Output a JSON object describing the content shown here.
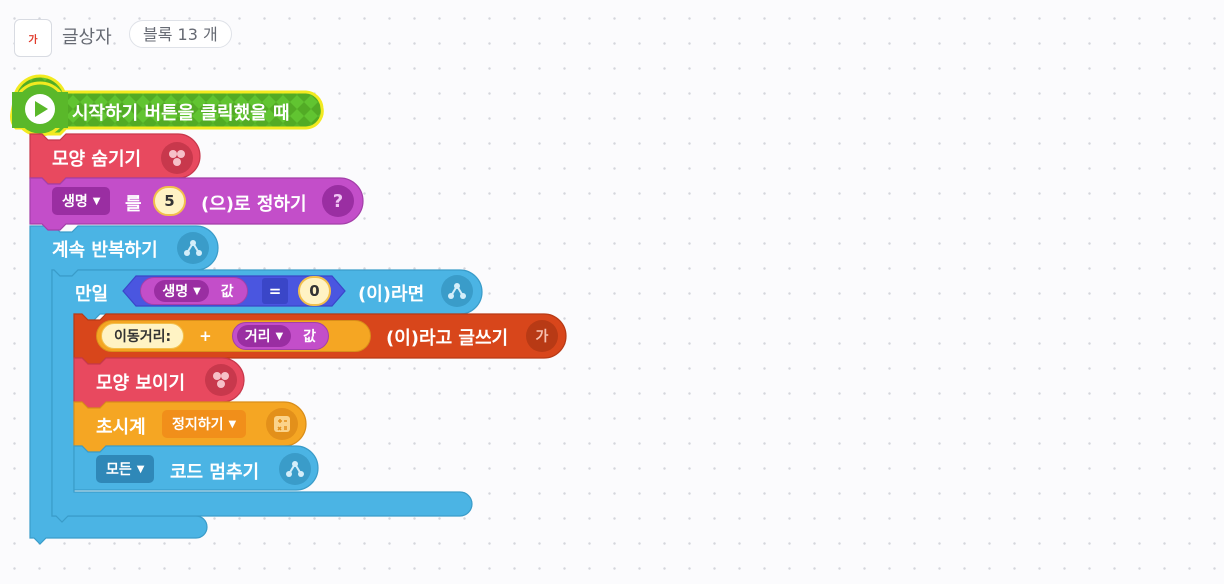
{
  "header": {
    "sprite_icon_char": "가",
    "sprite_name": "글상자",
    "block_count": "블록 13 개"
  },
  "script": {
    "start_block": {
      "label": "시작하기 버튼을 클릭했을 때",
      "icon": "play-icon"
    },
    "hide_block": {
      "label": "모양 숨기기",
      "icon": "shape-icon"
    },
    "set_var_block": {
      "variable": "생명",
      "particle": "를",
      "value": "5",
      "suffix": "(으)로 정하기",
      "icon": "question-icon"
    },
    "repeat_block": {
      "label": "계속 반복하기",
      "icon": "flow-icon"
    },
    "if_block": {
      "prefix": "만일",
      "left_var": "생명",
      "left_var_suffix": "값",
      "operator": "=",
      "right_value": "0",
      "suffix": "(이)라면",
      "icon": "flow-icon"
    },
    "write_block": {
      "text_value": "이동거리:",
      "join_op": "+",
      "var": "거리",
      "var_suffix": "값",
      "suffix": "(이)라고 글쓰기",
      "icon_char": "가"
    },
    "show_block": {
      "label": "모양 보이기",
      "icon": "shape-icon"
    },
    "timer_block": {
      "label": "초시계",
      "action": "정지하기",
      "icon": "calculator-icon"
    },
    "stop_block": {
      "target": "모든",
      "label": "코드 멈추기",
      "icon": "flow-icon"
    }
  },
  "colors": {
    "start": "#5ab82a",
    "start_outline": "#f2ea20",
    "looks": "#e8495f",
    "variable": "#c34ec9",
    "flow": "#4bb4e4",
    "judge": "#4a56e0",
    "text": "#d8461b",
    "calc": "#f5a623"
  }
}
